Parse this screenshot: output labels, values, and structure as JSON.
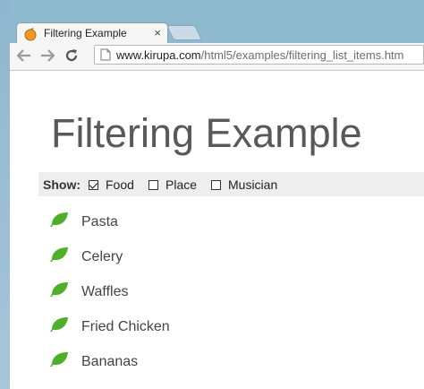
{
  "browser": {
    "tab_title": "Filtering Example",
    "tab_close": "×",
    "url_host": "www.kirupa.com",
    "url_path": "/html5/examples/filtering_list_items.htm"
  },
  "page": {
    "heading": "Filtering Example",
    "filter_label": "Show:",
    "filters": [
      {
        "label": "Food",
        "checked": true
      },
      {
        "label": "Place",
        "checked": false
      },
      {
        "label": "Musician",
        "checked": false
      }
    ],
    "items": [
      {
        "label": "Pasta",
        "icon": "leaf-icon"
      },
      {
        "label": "Celery",
        "icon": "leaf-icon"
      },
      {
        "label": "Waffles",
        "icon": "leaf-icon"
      },
      {
        "label": "Fried Chicken",
        "icon": "leaf-icon"
      },
      {
        "label": "Bananas",
        "icon": "leaf-icon"
      }
    ]
  },
  "colors": {
    "leaf": "#4fae2a",
    "heading": "#595959",
    "filter_bar": "#eeeeee"
  }
}
